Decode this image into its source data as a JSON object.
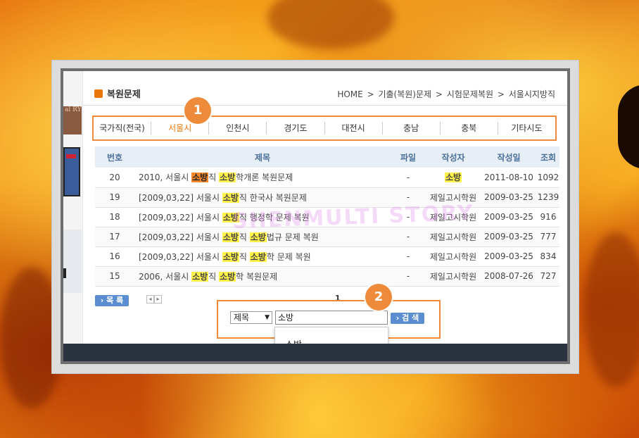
{
  "page": {
    "title": "복원문제",
    "breadcrumb": [
      "HOME",
      ">",
      "기출(복원)문제",
      ">",
      "시험문제복원",
      ">",
      "서울시지방직"
    ],
    "left_strip_fragment": "al RY"
  },
  "tabs": [
    {
      "label": "국가직(전국)",
      "active": false
    },
    {
      "label": "서울시",
      "active": true
    },
    {
      "label": "인천시",
      "active": false
    },
    {
      "label": "경기도",
      "active": false
    },
    {
      "label": "대전시",
      "active": false
    },
    {
      "label": "충남",
      "active": false
    },
    {
      "label": "충북",
      "active": false
    },
    {
      "label": "기타시도",
      "active": false
    }
  ],
  "badges": {
    "tabs": "1",
    "search": "2"
  },
  "table": {
    "headers": [
      "번호",
      "제목",
      "파일",
      "작성자",
      "작성일",
      "조회"
    ],
    "rows": [
      {
        "num": "20",
        "subject": [
          "2010, 서울시 ",
          "[o]소방",
          "직 ",
          "[y]소방",
          "학개론 복원문제"
        ],
        "file": "-",
        "author": "소방",
        "author_hl": true,
        "date": "2011-08-10",
        "views": "1092"
      },
      {
        "num": "19",
        "subject": [
          "[2009,03,22] 서울시 ",
          "[y]소방",
          "직 한국사 복원문제"
        ],
        "file": "-",
        "author": "제일고시학원",
        "author_hl": false,
        "date": "2009-03-25",
        "views": "1239"
      },
      {
        "num": "18",
        "subject": [
          "[2009,03,22] 서울시 ",
          "[y]소방",
          "직 행정학 문제 복원"
        ],
        "file": "-",
        "author": "제일고시학원",
        "author_hl": false,
        "date": "2009-03-25",
        "views": "916"
      },
      {
        "num": "17",
        "subject": [
          "[2009,03,22] 서울시 ",
          "[y]소방",
          "직 ",
          "[y]소방",
          "법규 문제 복원"
        ],
        "file": "-",
        "author": "제일고시학원",
        "author_hl": false,
        "date": "2009-03-25",
        "views": "777"
      },
      {
        "num": "16",
        "subject": [
          "[2009,03,22] 서울시 ",
          "[y]소방",
          "직 ",
          "[y]소방",
          "학 문제 복원"
        ],
        "file": "-",
        "author": "제일고시학원",
        "author_hl": false,
        "date": "2009-03-25",
        "views": "834"
      },
      {
        "num": "15",
        "subject": [
          "2006, 서울시 ",
          "[y]소방",
          "직 ",
          "[y]소방",
          "학 복원문제"
        ],
        "file": "-",
        "author": "제일고시학원",
        "author_hl": false,
        "date": "2008-07-26",
        "views": "727"
      }
    ]
  },
  "watermark": "SHENMULTI STORY",
  "controls": {
    "list_button": "목 록",
    "pager_prev": "◂",
    "pager_next": "▸",
    "current_page": "1",
    "search_field_select": "제목",
    "search_value": "소방",
    "search_button": "검 색",
    "autocomplete_suggestion": "소방"
  },
  "colors": {
    "accent_orange": "#ef8a3a",
    "highlight_yellow": "#fff24a",
    "button_blue": "#5a8ed0"
  }
}
